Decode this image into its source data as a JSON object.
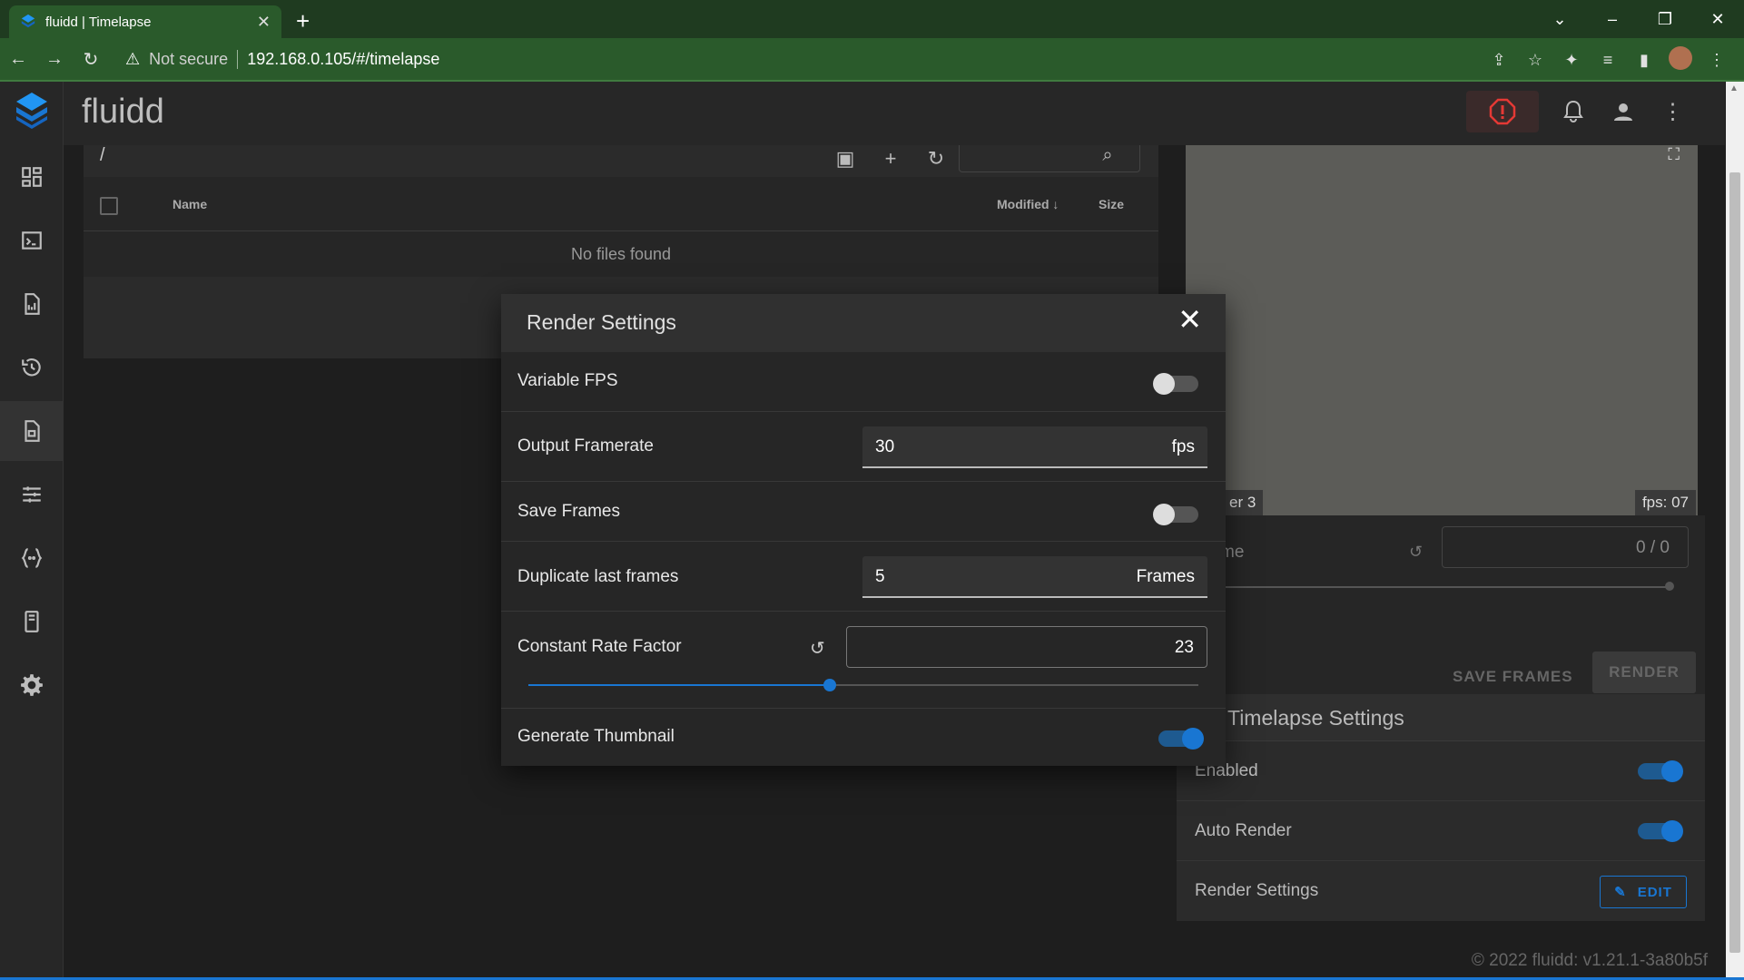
{
  "browser": {
    "tab_title": "fluidd | Timelapse",
    "not_secure": "Not secure",
    "url": "192.168.0.105/#/timelapse"
  },
  "app": {
    "brand": "fluidd"
  },
  "files": {
    "path": "/",
    "columns": {
      "name": "Name",
      "modified": "Modified",
      "size": "Size"
    },
    "empty_text": "No files found"
  },
  "camera": {
    "label_left": "er 3",
    "fps": "fps: 07"
  },
  "frames": {
    "label": "me",
    "counter": "0 / 0",
    "save_frames": "SAVE FRAMES",
    "render": "RENDER"
  },
  "timelapse_settings": {
    "title": "Timelapse Settings",
    "enabled_label": "Enabled",
    "enabled": true,
    "auto_render_label": "Auto Render",
    "auto_render": true,
    "render_settings_label": "Render Settings",
    "edit_label": "EDIT"
  },
  "dialog": {
    "title": "Render Settings",
    "variable_fps": {
      "label": "Variable FPS",
      "on": false
    },
    "output_framerate": {
      "label": "Output Framerate",
      "value": "30",
      "suffix": "fps"
    },
    "save_frames": {
      "label": "Save Frames",
      "on": false
    },
    "duplicate_last": {
      "label": "Duplicate last frames",
      "value": "5",
      "suffix": "Frames"
    },
    "crf": {
      "label": "Constant Rate Factor",
      "value": "23",
      "slider_fraction": 0.45
    },
    "generate_thumbnail": {
      "label": "Generate Thumbnail",
      "on": true
    }
  },
  "footer": "© 2022 fluidd: v1.21.1-3a80b5f",
  "colors": {
    "accent": "#1976d2",
    "browser_frame": "#2a5a2b"
  }
}
